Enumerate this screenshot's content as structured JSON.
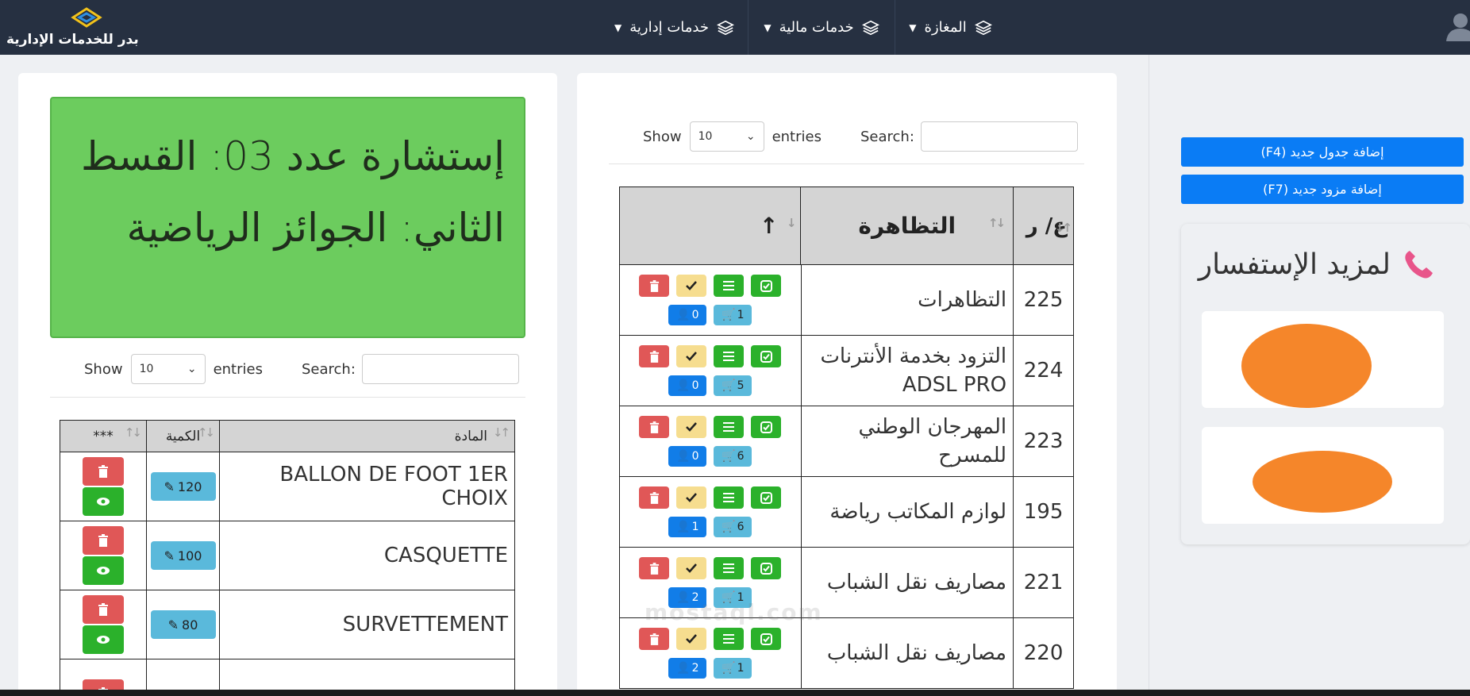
{
  "brand": {
    "name": "بدر للخدمات الإدارية"
  },
  "nav": [
    {
      "label": "المغازة"
    },
    {
      "label": "خدمات مالية"
    },
    {
      "label": "خدمات إدارية"
    }
  ],
  "left_panel": {
    "banner_text": "إستشارة عدد 03: القسط الثاني: الجوائز الرياضية",
    "controls": {
      "show_label": "Show",
      "entries_value": "10",
      "entries_label": "entries",
      "search_label": "Search:"
    },
    "table": {
      "headers": {
        "item": "المادة",
        "qty": "الكمية",
        "actions": "***"
      },
      "rows": [
        {
          "item": "BALLON DE FOOT 1ER CHOIX",
          "qty": "120"
        },
        {
          "item": "CASQUETTE",
          "qty": "100"
        },
        {
          "item": "SURVETTEMENT",
          "qty": "80"
        }
      ]
    }
  },
  "mid_panel": {
    "controls": {
      "show_label": "Show",
      "entries_value": "10",
      "entries_label": "entries",
      "search_label": "Search:"
    },
    "table": {
      "headers": {
        "num": "ع/ ر",
        "event": "التظاهرة",
        "actions": "↑"
      },
      "rows": [
        {
          "num": "225",
          "event": "التظاهرات",
          "users": "0",
          "cart": "1"
        },
        {
          "num": "224",
          "event": "التزود بخدمة الأنترنات ADSL PRO",
          "users": "0",
          "cart": "5"
        },
        {
          "num": "223",
          "event": "المهرجان الوطني للمسرح",
          "users": "0",
          "cart": "6"
        },
        {
          "num": "195",
          "event": "لوازم المكاتب رياضة",
          "users": "1",
          "cart": "6"
        },
        {
          "num": "221",
          "event": "مصاريف نقل الشباب",
          "users": "2",
          "cart": "1"
        },
        {
          "num": "220",
          "event": "مصاريف نقل الشباب",
          "users": "2",
          "cart": "1"
        }
      ]
    }
  },
  "sidebar": {
    "add_table_label": "إضافة جدول جديد (F4)",
    "add_supplier_label": "إضافة مزود جديد (F7)",
    "info_title": "لمزيد الإستفسار"
  },
  "watermark": {
    "text": "mostaql.com"
  },
  "colors": {
    "navbar": "#263041",
    "banner": "#6ccc5e",
    "primary": "#0a7cf5",
    "danger": "#e05757",
    "success": "#2bb12b"
  }
}
